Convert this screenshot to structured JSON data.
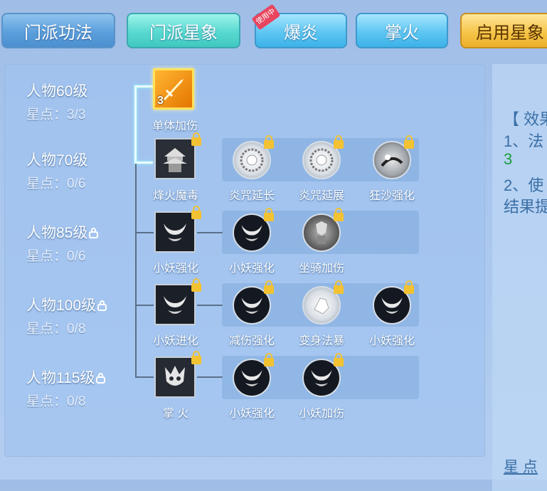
{
  "tabs": [
    {
      "label": "门派功法"
    },
    {
      "label": "门派星象"
    },
    {
      "label": "爆炎",
      "badge": "使用中"
    },
    {
      "label": "掌火"
    },
    {
      "label": "启用星象"
    }
  ],
  "levels": [
    {
      "name": "人物60级",
      "stars": "星点：3/3",
      "locked": false
    },
    {
      "name": "人物70级",
      "stars": "星点：0/6",
      "locked": false
    },
    {
      "name": "人物85级",
      "stars": "星点：0/6",
      "locked": true
    },
    {
      "name": "人物100级",
      "stars": "星点：0/8",
      "locked": true
    },
    {
      "name": "人物115级",
      "stars": "星点：0/8",
      "locked": true
    }
  ],
  "skills": {
    "r1_main": {
      "label": "单体加伤",
      "count": "3",
      "icon": "sword-icon"
    },
    "r2_main": {
      "label": "烽火魔毒",
      "icon": "pagoda-fire-icon"
    },
    "r2_s1": {
      "label": "炎咒延长",
      "icon": "seal-wheel-icon"
    },
    "r2_s2": {
      "label": "炎咒延展",
      "icon": "seal-wheel-icon"
    },
    "r2_s3": {
      "label": "狂沙强化",
      "icon": "sandstorm-icon"
    },
    "r3_main": {
      "label": "小妖强化",
      "icon": "demon-icon"
    },
    "r3_s1": {
      "label": "小妖强化",
      "icon": "demon-icon"
    },
    "r3_s2": {
      "label": "坐骑加伤",
      "icon": "mount-warrior-icon"
    },
    "r4_main": {
      "label": "小妖进化",
      "icon": "demon-icon"
    },
    "r4_s1": {
      "label": "减伤强化",
      "icon": "demon-icon"
    },
    "r4_s2": {
      "label": "变身法暴",
      "icon": "fist-icon"
    },
    "r4_s3": {
      "label": "小妖强化",
      "icon": "demon-icon"
    },
    "r5_main": {
      "label": "掌 火",
      "icon": "flame-demon-icon"
    },
    "r5_s1": {
      "label": "小妖强化",
      "icon": "demon-icon"
    },
    "r5_s2": {
      "label": "小妖加伤",
      "icon": "demon-icon"
    }
  },
  "right_panel": {
    "line1": "【 效果",
    "line2": "1、法",
    "line3": "3",
    "line4": "2、使",
    "line5": "结果提",
    "footer": "星 点"
  },
  "colors": {
    "green_value": "#1b9e3a",
    "accent_gold": "#ffe25a"
  }
}
